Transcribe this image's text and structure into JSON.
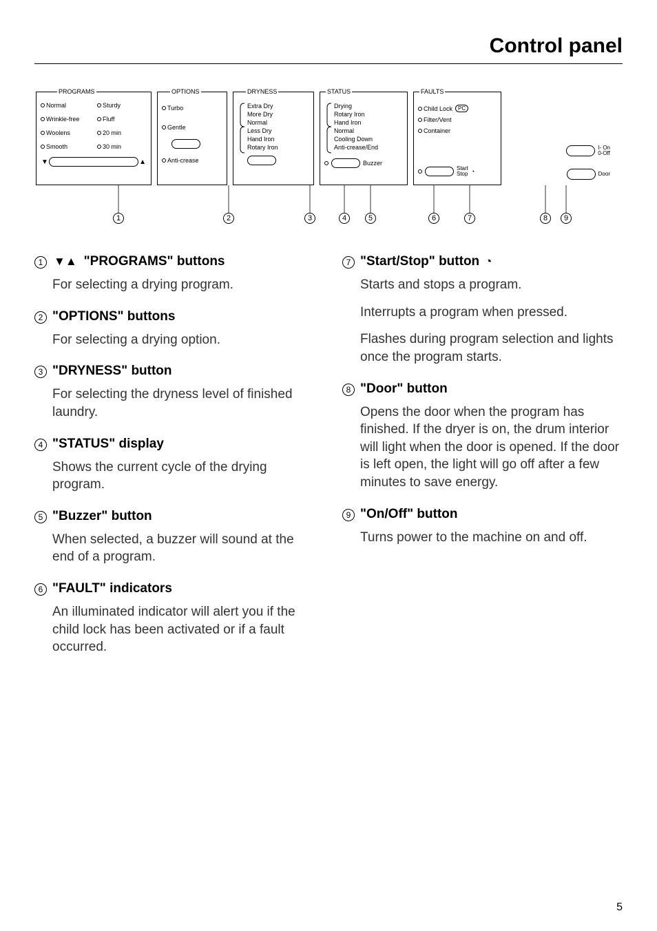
{
  "page": {
    "title": "Control panel",
    "number": "5"
  },
  "panel": {
    "programs": {
      "title": "PROGRAMS",
      "left": [
        "Normal",
        "Wrinkle-free",
        "Woolens",
        "Smooth"
      ],
      "right": [
        "Sturdy",
        "Fluff",
        "20 min",
        "30 min"
      ]
    },
    "options": {
      "title": "OPTIONS",
      "items": [
        "Turbo",
        "Gentle",
        "Anti-crease"
      ]
    },
    "dryness": {
      "title": "DRYNESS",
      "items": [
        "Extra Dry",
        "More Dry",
        "Normal",
        "Less Dry",
        "Hand Iron",
        "Rotary Iron"
      ]
    },
    "status": {
      "title": "STATUS",
      "items": [
        "Drying",
        "Rotary Iron",
        "Hand Iron",
        "Normal",
        "Cooling Down",
        "Anti-crease/End"
      ],
      "buzzer": "Buzzer"
    },
    "faults": {
      "title": "FAULTS",
      "items": [
        "Child Lock",
        "Filter/Vent",
        "Container"
      ],
      "pc": "PC",
      "start_stop": "Start\nStop"
    },
    "right": {
      "on_off": "I- On\n0-Off",
      "door": "Door"
    },
    "callout_numbers": [
      "1",
      "2",
      "3",
      "4",
      "5",
      "6",
      "7",
      "8",
      "9"
    ]
  },
  "descriptions": {
    "d1": {
      "title": "\"PROGRAMS\" buttons",
      "text": "For selecting a drying program."
    },
    "d2": {
      "title": "\"OPTIONS\" buttons",
      "text": "For selecting a drying option."
    },
    "d3": {
      "title": "\"DRYNESS\" button",
      "text": "For selecting the dryness level of finished laundry."
    },
    "d4": {
      "title": "\"STATUS\" display",
      "text": "Shows the current cycle of the drying program."
    },
    "d5": {
      "title": "\"Buzzer\" button",
      "text": "When selected, a buzzer will sound at the end of a program."
    },
    "d6": {
      "title": "\"FAULT\" indicators",
      "text": "An illuminated indicator will alert you if the child lock has been activated or if a fault occurred."
    },
    "d7": {
      "title": "\"Start/Stop\" button",
      "text1": "Starts and stops a program.",
      "text2": "Interrupts a program when pressed.",
      "text3": "Flashes during program selection and lights once the program starts."
    },
    "d8": {
      "title": "\"Door\" button",
      "text": "Opens the door when the program has finished. If the dryer is on, the drum interior will light when the door is opened. If the door is left open, the light will go off after a few minutes to save energy."
    },
    "d9": {
      "title": "\"On/Off\" button",
      "text": "Turns power to the machine on and off."
    }
  }
}
